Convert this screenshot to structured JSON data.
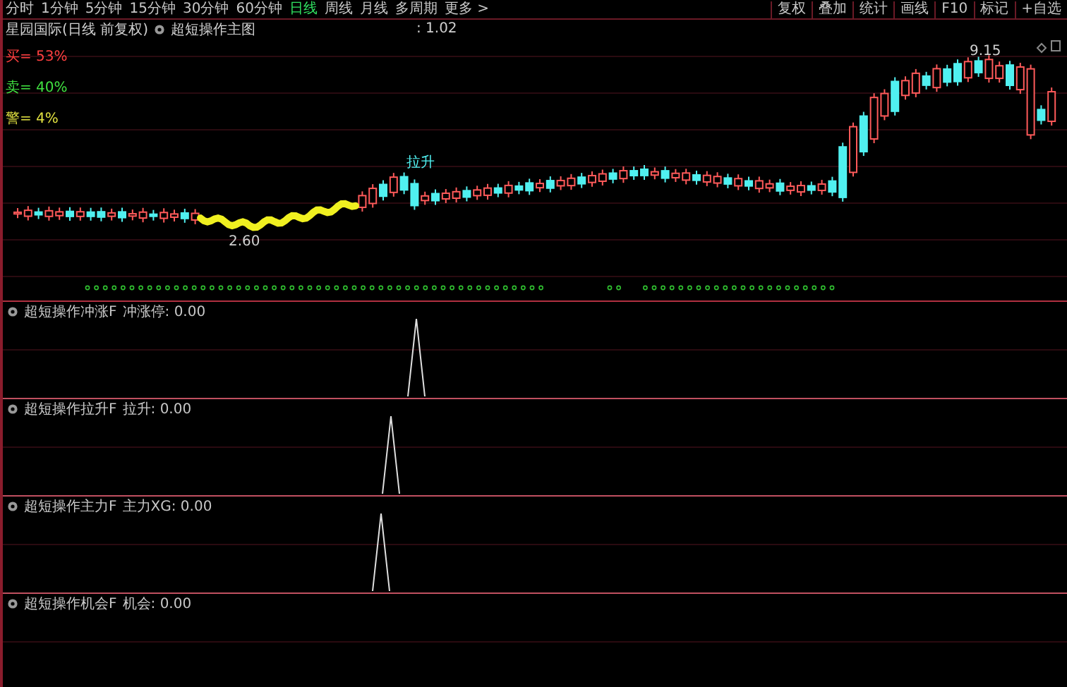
{
  "period_tabs": [
    {
      "label": "分时",
      "selected": false
    },
    {
      "label": "1分钟",
      "selected": false
    },
    {
      "label": "5分钟",
      "selected": false
    },
    {
      "label": "15分钟",
      "selected": false
    },
    {
      "label": "30分钟",
      "selected": false
    },
    {
      "label": "60分钟",
      "selected": false
    },
    {
      "label": "日线",
      "selected": true
    },
    {
      "label": "周线",
      "selected": false
    },
    {
      "label": "月线",
      "selected": false
    },
    {
      "label": "多周期",
      "selected": false
    },
    {
      "label": "更多 >",
      "selected": false
    }
  ],
  "tools": [
    "复权",
    "叠加",
    "统计",
    "画线",
    "F10",
    "标记",
    "+自选"
  ],
  "main_chart": {
    "title": "星园国际(日线 前复权)",
    "indicator": "超短操作主图",
    "value": ": 1.02",
    "stats": [
      {
        "label": "买= 53%",
        "color": "#ff4040"
      },
      {
        "label": "卖= 40%",
        "color": "#40e040"
      },
      {
        "label": "警= 4%",
        "color": "#e0e040"
      }
    ],
    "annotations": [
      {
        "kind": "price",
        "text": "2.60"
      },
      {
        "kind": "signal",
        "text": "拉升"
      },
      {
        "kind": "peak",
        "text": "9.15"
      }
    ]
  },
  "panels": [
    {
      "name": "超短操作冲涨F",
      "reading": "冲涨停: 0.00"
    },
    {
      "name": "超短操作拉升F",
      "reading": "拉升: 0.00"
    },
    {
      "name": "超短操作主力F",
      "reading": "主力XG: 0.00"
    },
    {
      "name": "超短操作机会F",
      "reading": "机会: 0.00"
    }
  ]
}
